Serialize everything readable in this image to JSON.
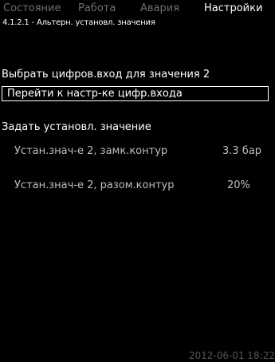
{
  "tabs": [
    {
      "label": "Состояние"
    },
    {
      "label": "Работа"
    },
    {
      "label": "Авария"
    },
    {
      "label": "Настройки"
    }
  ],
  "breadcrumb": "4.1.2.1 - Альтерн. установл. значения",
  "digital_input": {
    "heading": "Выбрать цифров.вход для значения 2",
    "link_label": "Перейти к настр-ке цифр.входа"
  },
  "setpoint": {
    "heading": "Задать установл. значение",
    "rows": [
      {
        "label": "Устан.знач-е 2, замк.контур",
        "value": "3.3 бар"
      },
      {
        "label": "Устан.знач-е 2, разом.контур",
        "value": "20%"
      }
    ]
  },
  "status_bar": {
    "datetime": "2012-06-01 18:22"
  },
  "colors": {
    "background": "#000000",
    "active_text": "#ffffff",
    "inactive_tab": "#6e6e6e",
    "value_text": "#bdbdbd",
    "timestamp": "#555555"
  }
}
